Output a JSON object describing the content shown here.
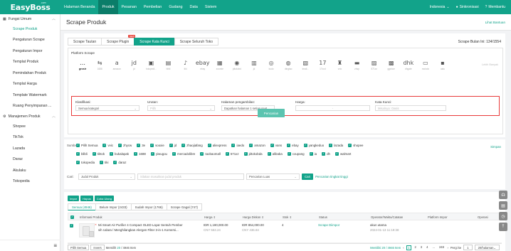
{
  "logo": {
    "text": "EasyBoss",
    "sub": ".com"
  },
  "nav": {
    "items": [
      "Halaman Beranda",
      "Produk",
      "Pesanan",
      "Pembelian",
      "Gudang",
      "Data",
      "Sistem"
    ],
    "active_index": 1
  },
  "top_right": {
    "language": "Indonesia",
    "sync": "Sinkronisasi",
    "help": "Membantu"
  },
  "sidebar": {
    "group1": "Fungsi Umum",
    "items1": [
      "Scrape Produk",
      "Pengaturan Scrape",
      "Pengaturan Impor",
      "Templat Produk",
      "Pemindahan Produk",
      "Templat Harga",
      "Template Watermark",
      "Ruang Penyimpanan ..."
    ],
    "active_index": 0,
    "group2": "Manajemen Produk",
    "items2": [
      "Shopee",
      "TikTok",
      "Lazada",
      "Daraz",
      "Akulaku",
      "Tokopedia"
    ],
    "bottom_icon": "≡"
  },
  "page": {
    "title": "Scrape Produk",
    "help_link": "Lihat Bantuan"
  },
  "scrape": {
    "tabs": [
      "Scrape Tautan",
      "Scrape Plugin",
      "Scrape Kata Kunci",
      "Scrape Seluruh Toko"
    ],
    "active_tab": 2,
    "new_badge": "NEW",
    "quota_label": "Scrape Bulan Ini:",
    "quota_value": "134/1554",
    "platform_label": "Platform Scrape",
    "platforms": [
      {
        "icon": "…",
        "label": "grosir"
      },
      {
        "icon": "⇆",
        "label": "1688"
      },
      {
        "icon": "a",
        "label": "amazon"
      },
      {
        "icon": "jd",
        "label": "jd"
      },
      {
        "icon": "▣",
        "label": "tokopedi..."
      },
      {
        "icon": "▤",
        "label": "bibli"
      },
      {
        "icon": "♪",
        "label": "tiki"
      },
      {
        "icon": "ebay",
        "label": "ebay"
      },
      {
        "icon": "▦",
        "label": "zoomie"
      },
      {
        "icon": "◉",
        "label": "jdtokobd"
      },
      {
        "icon": "▥",
        "label": "jd"
      },
      {
        "icon": "◎",
        "label": "kudo"
      },
      {
        "icon": "◍",
        "label": "dingtao"
      },
      {
        "icon": "▧",
        "label": "tmall..."
      },
      {
        "icon": "17",
        "label": "17vcd"
      },
      {
        "icon": "♜",
        "label": "vvic"
      },
      {
        "icon": "▬",
        "label": "zhsp"
      },
      {
        "icon": "▨",
        "label": "571xz"
      },
      {
        "icon": "▩",
        "label": "ggshoe"
      },
      {
        "icon": "dhk",
        "label": "dhgate"
      },
      {
        "icon": "▭",
        "label": "mokolo"
      },
      {
        "icon": "▪",
        "label": "aalu"
      }
    ],
    "platform_active": 0,
    "platform_extra": "Lebih Banyak",
    "filters": [
      {
        "label": "Klasifikasi:",
        "value": "Semua kategori",
        "placeholder": ""
      },
      {
        "label": "Urutan:",
        "value": "",
        "placeholder": "Pilih"
      },
      {
        "label": "Halaman pengambilan:",
        "value": "Dapatkan halaman 1 setiap saat",
        "placeholder": ""
      },
      {
        "label": "Harga:",
        "value": "",
        "placeholder": "-"
      },
      {
        "label": "Kata Kunci:",
        "value": "",
        "placeholder": "Misalnya: Oasis"
      }
    ],
    "search_button": "Pencarian"
  },
  "sources": {
    "label": "Sumber:",
    "row1": [
      "Pilih Semua",
      "vvic",
      "zhycw",
      "3e",
      "sooxie",
      "jd",
      "zhaojiafang",
      "aliexpress",
      "iaedo",
      "amazon",
      "vans",
      "ebay",
      "yangkeduo",
      "lazada",
      "shopee"
    ],
    "row2": [
      "blibli",
      "tiktok",
      "bukalapak",
      "1688",
      "yiwugou",
      "mercadolibre",
      "taobaomall",
      "571xz",
      "jdtokobda",
      "alibaba",
      "coupang",
      "ia",
      "dh",
      "walmart"
    ],
    "row3": [
      "tokopedia",
      "tiki",
      "daraz"
    ],
    "save_link": "Simpan"
  },
  "cari": {
    "label": "Cari:",
    "select_value": "Judul Produk",
    "input_placeholder": "Silakan masukkan judul produk",
    "sort_value": "Pencarian Luas",
    "button": "Cari",
    "advanced_link": "Pencarian tingkat tinggi"
  },
  "actions": {
    "buttons": [
      "Impor",
      "Hapus",
      "Coba Ulang"
    ]
  },
  "status_tabs": [
    "Semua (4946)",
    "Belum Impor (2433)",
    "Sudah Impor (1766)",
    "Scrape Gagal (747)"
  ],
  "status_active": 0,
  "table": {
    "headers": [
      "Informasi Produk",
      "Harga",
      "Harga Diskon",
      "Stok",
      "Status",
      "Operator/Waktu/Catatan",
      "Platform Impor",
      "Operasi"
    ],
    "rows": [
      {
        "title_line1": "Mi Smart Air Purifier 4 Compact OLED Layar Sentuh Pember",
        "title_line2": "sih Udara / Menghilangkan Alergen Filter 3-in-1 Komersi...",
        "price": "IDR 1,190,000.00",
        "price_cny": "CNY 553.24",
        "discount": "IDR 854,000.00",
        "discount_cny": "CNY 436.84",
        "stock": "4",
        "status": "Scrape Diimpor",
        "operator": "akun utama",
        "time": "2024-01-13 11:19:38"
      }
    ]
  },
  "bottom": {
    "select_all": "Pilih Semua",
    "invert": "Invers",
    "selected_prefix": "Memilih",
    "selected_count": "20",
    "selected_total": "/ 4946 Item",
    "total_text": "Memiliki 20 / 4946 Item",
    "pages": [
      "1",
      "2",
      "3",
      "4",
      "...",
      "248"
    ],
    "page_active": 0,
    "goto_label": "Pergi ke",
    "goto_value": "1",
    "per_page": "20/halaman"
  }
}
